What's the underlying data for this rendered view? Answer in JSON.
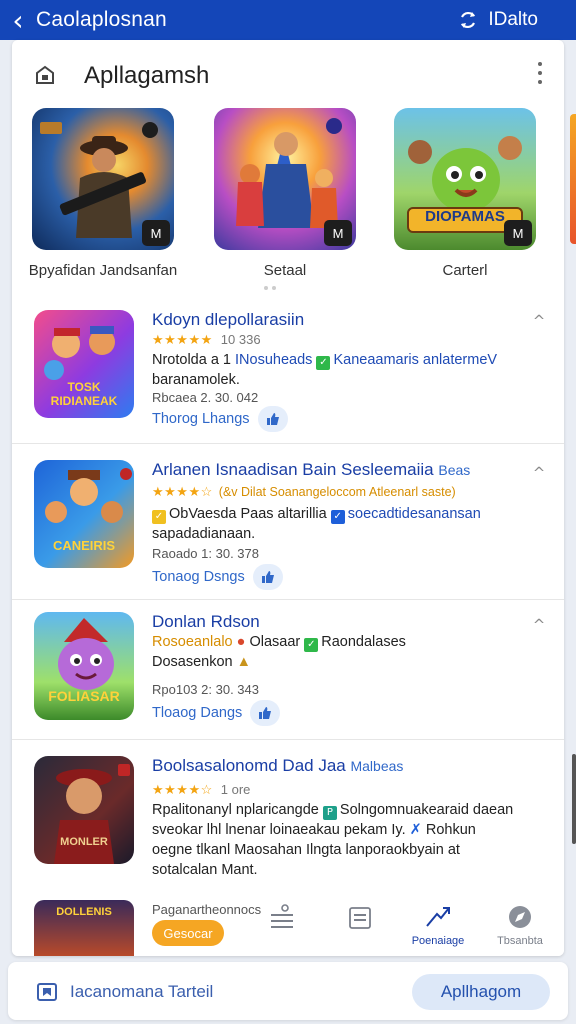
{
  "topbar": {
    "title": "Caolaplosnan",
    "right_label": "IDalto",
    "back_icon": "chevron-left-icon",
    "sync_icon": "sync-icon"
  },
  "section": {
    "title": "Apllagamsh",
    "icon": "tag-icon",
    "more_icon": "more-vertical-icon"
  },
  "featured": [
    {
      "caption": "Bpyafidan Jandsanfan",
      "badge": "M"
    },
    {
      "caption": "Setaal",
      "badge": "M"
    },
    {
      "caption": "Carterl",
      "badge": "M",
      "art_text": "DIOPAMAS"
    }
  ],
  "apps": [
    {
      "name": "Kdoyn dlepollarasiin",
      "stars": "★★★★★",
      "count": "10 336",
      "desc_a": "Nrotolda a 1 ",
      "desc_blue": "INosuheads",
      "desc_b": "Kaneaamaris anlatermeV",
      "desc_c": "baranamolek.",
      "meta": "Rbcaea 2. 30. 042",
      "link": "Thorog Lhangs",
      "art_text": "TOSK RIDIANEAK"
    },
    {
      "name": "Arlanen Isnaadisan Bain Sesleemaiia",
      "name_suffix": "Beas",
      "stars": "★★★★☆",
      "count": "",
      "extra": "(&v Dilat Soanangeloccom Atleenarl saste)",
      "desc_a": "ObVaesda Paas altarillia",
      "desc_blue": "soecadtidesanansan",
      "desc_c": "sapadadianaan.",
      "meta": "Raoado 1: 30. 378",
      "link": "Tonaog Dsngs",
      "art_text": "CANEIRIS"
    },
    {
      "name": "Donlan Rdson",
      "stars": "",
      "count": "",
      "extra": "Rosoeanlalo",
      "desc_a": "Olasaar",
      "desc_b": "Raondalases",
      "desc_c": "Dosasenkon",
      "meta": "Rpo103 2: 30. 343",
      "link": "Tloaog Dangs",
      "art_text": "FOLIASAR"
    },
    {
      "name": "Boolsasalonomd Dad Jaa",
      "name_suffix": "Malbeas",
      "stars": "★★★★☆",
      "count": "1 ore",
      "desc_a": "Rpalitonanyl nplaricangde",
      "desc_b": "Solngomnuakearaid daean",
      "desc_c": "sveokar lhl lnenar loinaeakau pekam Iy.",
      "desc_d": "Rohkun",
      "desc_e": "oegne tlkanl Maosahan Ilngta lanporaokbyain at",
      "desc_f": "sotalcalan Mant.",
      "art_text": "MONLER"
    }
  ],
  "partial_row": {
    "text": "Paganartheonnocs",
    "pill": "Gesocar",
    "art_text": "DOLLENIS"
  },
  "bottom_nav": [
    {
      "label": "",
      "icon": "menu-list-icon"
    },
    {
      "label": "",
      "icon": "document-icon"
    },
    {
      "label": "Poenaiage",
      "icon": "share-plane-icon",
      "active": true
    },
    {
      "label": "Tbsanbta",
      "icon": "compass-icon"
    }
  ],
  "footer": {
    "text": "Iacanomana Tarteil",
    "button": "Apllhagom",
    "icon": "chat-bookmark-icon"
  },
  "colors": {
    "brand_blue": "#1446b8",
    "link_blue": "#1a3ea5",
    "star_gold": "#f3a412",
    "pill_orange": "#f5a623"
  }
}
